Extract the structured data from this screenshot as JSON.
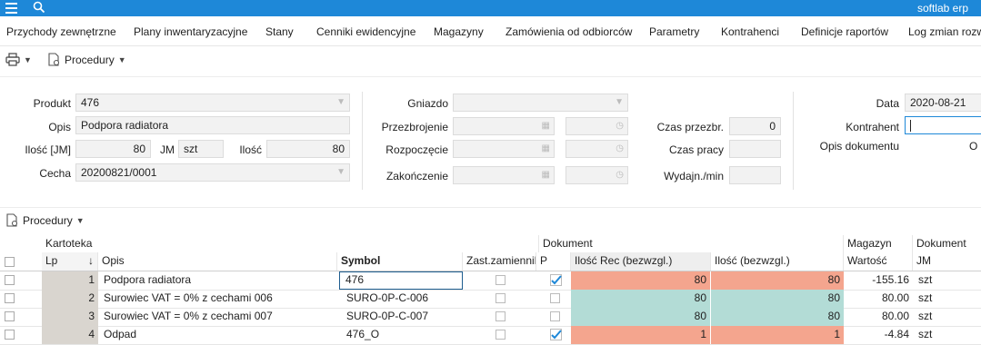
{
  "app": {
    "brand": "softlab erp"
  },
  "menu": [
    "Przychody zewnętrzne",
    "Plany inwentaryzacyjne",
    "Stany",
    "Cenniki ewidencyjne",
    "Magazyny",
    "Zamówienia od odbiorców",
    "Parametry",
    "Kontrahenci",
    "Definicje raportów",
    "Log zmian rozwo"
  ],
  "toolbar": {
    "procedury": "Procedury"
  },
  "form": {
    "produkt_label": "Produkt",
    "produkt": "476",
    "opis_label": "Opis",
    "opis": "Podpora radiatora",
    "ilosc_jm_label": "Ilość [JM]",
    "ilosc_jm": "80",
    "jm_label": "JM",
    "jm": "szt",
    "ilosc_label": "Ilość",
    "ilosc": "80",
    "cecha_label": "Cecha",
    "cecha": "20200821/0001",
    "gniazdo_label": "Gniazdo",
    "przezbrojenie_label": "Przezbrojenie",
    "rozpoczecie_label": "Rozpoczęcie",
    "zakonczenie_label": "Zakończenie",
    "czas_przezbr_label": "Czas przezbr.",
    "czas_przezbr": "0",
    "czas_pracy_label": "Czas pracy",
    "wydajn_label": "Wydajn./min",
    "data_label": "Data",
    "data": "2020-08-21",
    "kontrahent_label": "Kontrahent",
    "opis_dok_label": "Opis dokumentu",
    "opis_dok_cut": "O"
  },
  "grid": {
    "group_headers": {
      "kartoteka": "Kartoteka",
      "dokument": "Dokument",
      "magazyn": "Magazyn",
      "dokument2": "Dokument"
    },
    "headers": {
      "lp": "Lp",
      "opis": "Opis",
      "symbol": "Symbol",
      "zast": "Zast.zamiennik",
      "p": "P",
      "ilosc_rec": "Ilość Rec (bezwzgl.)",
      "ilosc_bez": "Ilość (bezwzgl.)",
      "wartosc": "Wartość",
      "jm": "JM"
    },
    "rows": [
      {
        "lp": "1",
        "opis": "Podpora radiatora",
        "symbol": "476",
        "p": true,
        "rec": "80",
        "bez": "80",
        "wartosc": "-155.16",
        "jm": "szt",
        "color": "#f4a58e"
      },
      {
        "lp": "2",
        "opis": "Surowiec VAT = 0% z cechami 006",
        "symbol": "SURO-0P-C-006",
        "p": false,
        "rec": "80",
        "bez": "80",
        "wartosc": "80.00",
        "jm": "szt",
        "color": "#b3dcd6"
      },
      {
        "lp": "3",
        "opis": "Surowiec VAT = 0% z cechami 007",
        "symbol": "SURO-0P-C-007",
        "p": false,
        "rec": "80",
        "bez": "80",
        "wartosc": "80.00",
        "jm": "szt",
        "color": "#b3dcd6"
      },
      {
        "lp": "4",
        "opis": "Odpad",
        "symbol": "476_O",
        "p": true,
        "rec": "1",
        "bez": "1",
        "wartosc": "-4.84",
        "jm": "szt",
        "color": "#f4a58e"
      }
    ]
  },
  "colors": {
    "accent": "#1e88d8"
  }
}
